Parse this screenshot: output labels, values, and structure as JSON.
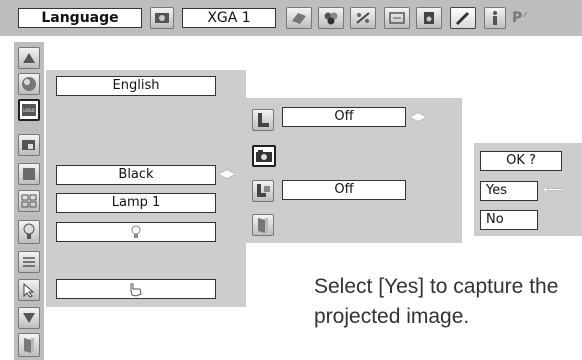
{
  "top_bar": {
    "language_label": "Language",
    "resolution_label": "XGA 1",
    "pc_badge": "P"
  },
  "sidebar": {
    "icons": [
      "arrow-up-icon",
      "color-icon",
      "logo-icon",
      "screen-icon",
      "background-icon",
      "display-icon",
      "lamp-icon",
      "setting-icon",
      "pointer-icon",
      "arrow-down-icon",
      "exit-icon"
    ]
  },
  "main_panel": {
    "items": {
      "language_value": "English",
      "background_value": "Black",
      "display_value": "Lamp 1",
      "lamp_value_icon": "lightbulb-icon",
      "pointer_value_icon": "hand-pointer-icon"
    }
  },
  "logo_submenu": {
    "logo_select_value": "Off",
    "logo_pin_value": "Off"
  },
  "confirm_dialog": {
    "title": "OK ?",
    "yes": "Yes",
    "no": "No"
  },
  "instruction": "Select [Yes] to capture the projected image."
}
